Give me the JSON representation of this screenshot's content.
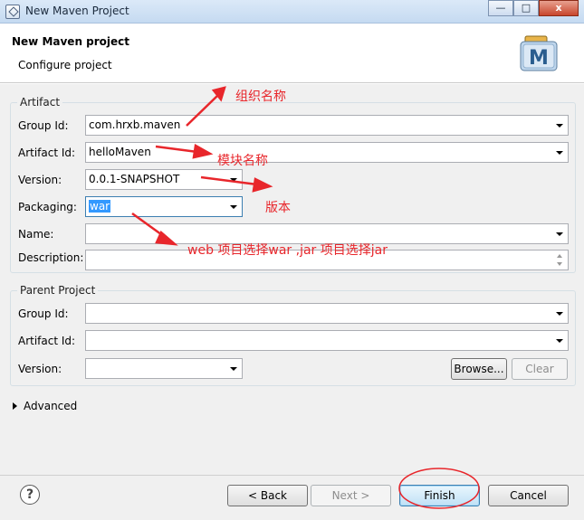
{
  "window": {
    "title": "New Maven Project",
    "minimize": "—",
    "maximize": "□",
    "close": "x"
  },
  "banner": {
    "title": "New Maven project",
    "subtitle": "Configure project",
    "logo_letter": "M"
  },
  "artifact": {
    "legend": "Artifact",
    "group_id": {
      "label": "Group Id:",
      "value": "com.hrxb.maven"
    },
    "artifact_id": {
      "label": "Artifact Id:",
      "value": "helloMaven"
    },
    "version": {
      "label": "Version:",
      "value": "0.0.1-SNAPSHOT"
    },
    "packaging": {
      "label": "Packaging:",
      "value": "war"
    },
    "name": {
      "label": "Name:",
      "value": ""
    },
    "description": {
      "label": "Description:",
      "value": ""
    }
  },
  "parent": {
    "legend": "Parent Project",
    "group_id": {
      "label": "Group Id:",
      "value": ""
    },
    "artifact_id": {
      "label": "Artifact Id:",
      "value": ""
    },
    "version": {
      "label": "Version:",
      "value": ""
    },
    "browse_label": "Browse...",
    "clear_label": "Clear"
  },
  "advanced_label": "Advanced",
  "footer": {
    "help": "?",
    "back": "< Back",
    "next": "Next >",
    "finish": "Finish",
    "cancel": "Cancel"
  },
  "annotations": {
    "org_name": "组织名称",
    "module_name": "模块名称",
    "version": "版本",
    "packaging_note": "web 项目选择war ,jar 项目选择jar"
  },
  "colors": {
    "annotation": "#e8262b",
    "selection": "#3399ff"
  }
}
